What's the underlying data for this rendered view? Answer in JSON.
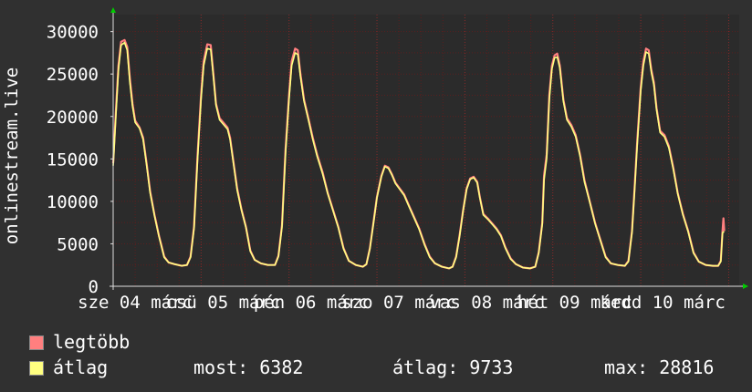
{
  "chart_data": {
    "type": "line",
    "ylabel": "onlinestream.live",
    "ylim": [
      0,
      32000
    ],
    "yticks": [
      0,
      5000,
      10000,
      15000,
      20000,
      25000,
      30000
    ],
    "xticks": [
      {
        "x": 0.25,
        "label": "sze 04 márc"
      },
      {
        "x": 1.25,
        "label": "csü 05 márc"
      },
      {
        "x": 2.25,
        "label": "pén 06 márc"
      },
      {
        "x": 3.25,
        "label": "szo 07 márc"
      },
      {
        "x": 4.25,
        "label": "vas 08 márc"
      },
      {
        "x": 5.25,
        "label": "hét 09 márc"
      },
      {
        "x": 6.25,
        "label": "kedd 10 márc"
      }
    ],
    "xlim": [
      0,
      7.12
    ],
    "grid": true,
    "colors": {
      "background": "#303030",
      "plot": "#2b2b2b",
      "grid": "#5a1f1f",
      "max_series": "#ff7f7f",
      "avg_series": "#ffff80",
      "axis": "#ffffff",
      "arrow": "#00cc00"
    },
    "series": [
      {
        "name": "legtöbb",
        "color": "#ff7f7f",
        "points": [
          [
            0.0,
            14500
          ],
          [
            0.03,
            20500
          ],
          [
            0.06,
            26000
          ],
          [
            0.09,
            28800
          ],
          [
            0.13,
            29000
          ],
          [
            0.16,
            28200
          ],
          [
            0.19,
            24500
          ],
          [
            0.22,
            21500
          ],
          [
            0.25,
            19500
          ],
          [
            0.3,
            18700
          ],
          [
            0.34,
            17500
          ],
          [
            0.38,
            14500
          ],
          [
            0.42,
            11200
          ],
          [
            0.47,
            8400
          ],
          [
            0.52,
            6000
          ],
          [
            0.58,
            3500
          ],
          [
            0.63,
            2800
          ],
          [
            0.7,
            2600
          ],
          [
            0.78,
            2400
          ],
          [
            0.84,
            2500
          ],
          [
            0.88,
            3500
          ],
          [
            0.92,
            7000
          ],
          [
            0.96,
            15500
          ],
          [
            1.0,
            22500
          ],
          [
            1.03,
            26500
          ],
          [
            1.07,
            28500
          ],
          [
            1.11,
            28400
          ],
          [
            1.14,
            25000
          ],
          [
            1.17,
            21500
          ],
          [
            1.21,
            19800
          ],
          [
            1.26,
            19200
          ],
          [
            1.3,
            18700
          ],
          [
            1.33,
            17500
          ],
          [
            1.37,
            14500
          ],
          [
            1.41,
            11500
          ],
          [
            1.46,
            9000
          ],
          [
            1.51,
            7000
          ],
          [
            1.56,
            4200
          ],
          [
            1.61,
            3100
          ],
          [
            1.68,
            2700
          ],
          [
            1.76,
            2500
          ],
          [
            1.84,
            2500
          ],
          [
            1.88,
            3600
          ],
          [
            1.92,
            7200
          ],
          [
            1.96,
            16000
          ],
          [
            2.0,
            22500
          ],
          [
            2.03,
            26500
          ],
          [
            2.07,
            28000
          ],
          [
            2.1,
            27800
          ],
          [
            2.13,
            25000
          ],
          [
            2.17,
            22000
          ],
          [
            2.22,
            19800
          ],
          [
            2.27,
            17500
          ],
          [
            2.32,
            15500
          ],
          [
            2.38,
            13500
          ],
          [
            2.44,
            11000
          ],
          [
            2.5,
            9000
          ],
          [
            2.56,
            7000
          ],
          [
            2.62,
            4500
          ],
          [
            2.68,
            3000
          ],
          [
            2.76,
            2500
          ],
          [
            2.84,
            2300
          ],
          [
            2.88,
            2600
          ],
          [
            2.92,
            4500
          ],
          [
            2.96,
            7500
          ],
          [
            3.0,
            10500
          ],
          [
            3.05,
            13000
          ],
          [
            3.09,
            14200
          ],
          [
            3.13,
            14000
          ],
          [
            3.17,
            13200
          ],
          [
            3.21,
            12200
          ],
          [
            3.26,
            11500
          ],
          [
            3.31,
            10800
          ],
          [
            3.36,
            9600
          ],
          [
            3.42,
            8200
          ],
          [
            3.48,
            6800
          ],
          [
            3.54,
            5000
          ],
          [
            3.6,
            3500
          ],
          [
            3.66,
            2700
          ],
          [
            3.74,
            2300
          ],
          [
            3.82,
            2100
          ],
          [
            3.86,
            2300
          ],
          [
            3.9,
            3500
          ],
          [
            3.94,
            6000
          ],
          [
            3.98,
            9000
          ],
          [
            4.02,
            11500
          ],
          [
            4.06,
            12700
          ],
          [
            4.1,
            12900
          ],
          [
            4.14,
            12300
          ],
          [
            4.17,
            10500
          ],
          [
            4.21,
            8500
          ],
          [
            4.26,
            8000
          ],
          [
            4.31,
            7400
          ],
          [
            4.36,
            6800
          ],
          [
            4.41,
            6000
          ],
          [
            4.46,
            4600
          ],
          [
            4.52,
            3300
          ],
          [
            4.58,
            2600
          ],
          [
            4.66,
            2200
          ],
          [
            4.74,
            2100
          ],
          [
            4.8,
            2300
          ],
          [
            4.84,
            4000
          ],
          [
            4.88,
            7500
          ],
          [
            4.9,
            13000
          ],
          [
            4.93,
            15500
          ],
          [
            4.96,
            22500
          ],
          [
            4.99,
            26000
          ],
          [
            5.02,
            27200
          ],
          [
            5.05,
            27400
          ],
          [
            5.08,
            26000
          ],
          [
            5.12,
            22000
          ],
          [
            5.16,
            19800
          ],
          [
            5.21,
            19000
          ],
          [
            5.26,
            17800
          ],
          [
            5.31,
            15500
          ],
          [
            5.36,
            12500
          ],
          [
            5.42,
            10000
          ],
          [
            5.48,
            7500
          ],
          [
            5.54,
            5500
          ],
          [
            5.6,
            3500
          ],
          [
            5.66,
            2700
          ],
          [
            5.74,
            2500
          ],
          [
            5.82,
            2400
          ],
          [
            5.86,
            3000
          ],
          [
            5.9,
            6500
          ],
          [
            5.93,
            11500
          ],
          [
            5.96,
            17000
          ],
          [
            6.0,
            23500
          ],
          [
            6.03,
            26500
          ],
          [
            6.06,
            28000
          ],
          [
            6.09,
            27800
          ],
          [
            6.12,
            25500
          ],
          [
            6.15,
            24000
          ],
          [
            6.18,
            21000
          ],
          [
            6.22,
            18300
          ],
          [
            6.27,
            17800
          ],
          [
            6.32,
            16500
          ],
          [
            6.37,
            14000
          ],
          [
            6.42,
            11000
          ],
          [
            6.48,
            8500
          ],
          [
            6.54,
            6500
          ],
          [
            6.6,
            4000
          ],
          [
            6.66,
            2900
          ],
          [
            6.74,
            2500
          ],
          [
            6.82,
            2400
          ],
          [
            6.88,
            2400
          ],
          [
            6.91,
            3000
          ],
          [
            6.93,
            6500
          ],
          [
            6.94,
            8000
          ],
          [
            6.95,
            6500
          ]
        ]
      },
      {
        "name": "átlag",
        "color": "#ffff80",
        "points": [
          [
            0.0,
            14200
          ],
          [
            0.03,
            20000
          ],
          [
            0.06,
            25500
          ],
          [
            0.09,
            28400
          ],
          [
            0.13,
            28700
          ],
          [
            0.16,
            27800
          ],
          [
            0.19,
            24000
          ],
          [
            0.22,
            21200
          ],
          [
            0.25,
            19300
          ],
          [
            0.3,
            18600
          ],
          [
            0.34,
            17300
          ],
          [
            0.38,
            14300
          ],
          [
            0.42,
            11000
          ],
          [
            0.47,
            8300
          ],
          [
            0.52,
            5900
          ],
          [
            0.58,
            3400
          ],
          [
            0.63,
            2800
          ],
          [
            0.7,
            2600
          ],
          [
            0.78,
            2400
          ],
          [
            0.84,
            2500
          ],
          [
            0.88,
            3400
          ],
          [
            0.92,
            6800
          ],
          [
            0.96,
            15000
          ],
          [
            1.0,
            22000
          ],
          [
            1.03,
            26000
          ],
          [
            1.07,
            28000
          ],
          [
            1.11,
            27900
          ],
          [
            1.14,
            24700
          ],
          [
            1.17,
            21300
          ],
          [
            1.21,
            19600
          ],
          [
            1.26,
            19000
          ],
          [
            1.3,
            18500
          ],
          [
            1.33,
            17300
          ],
          [
            1.37,
            14300
          ],
          [
            1.41,
            11300
          ],
          [
            1.46,
            8900
          ],
          [
            1.51,
            6900
          ],
          [
            1.56,
            4100
          ],
          [
            1.61,
            3100
          ],
          [
            1.68,
            2700
          ],
          [
            1.76,
            2500
          ],
          [
            1.84,
            2500
          ],
          [
            1.88,
            3500
          ],
          [
            1.92,
            7000
          ],
          [
            1.96,
            15500
          ],
          [
            2.0,
            22000
          ],
          [
            2.03,
            26000
          ],
          [
            2.07,
            27500
          ],
          [
            2.1,
            27300
          ],
          [
            2.13,
            24700
          ],
          [
            2.17,
            21800
          ],
          [
            2.22,
            19600
          ],
          [
            2.27,
            17300
          ],
          [
            2.32,
            15300
          ],
          [
            2.38,
            13300
          ],
          [
            2.44,
            10900
          ],
          [
            2.5,
            8900
          ],
          [
            2.56,
            6900
          ],
          [
            2.62,
            4400
          ],
          [
            2.68,
            3000
          ],
          [
            2.76,
            2500
          ],
          [
            2.84,
            2300
          ],
          [
            2.88,
            2600
          ],
          [
            2.92,
            4400
          ],
          [
            2.96,
            7400
          ],
          [
            3.0,
            10400
          ],
          [
            3.05,
            12900
          ],
          [
            3.09,
            14100
          ],
          [
            3.13,
            13900
          ],
          [
            3.17,
            13100
          ],
          [
            3.21,
            12100
          ],
          [
            3.26,
            11400
          ],
          [
            3.31,
            10700
          ],
          [
            3.36,
            9500
          ],
          [
            3.42,
            8100
          ],
          [
            3.48,
            6700
          ],
          [
            3.54,
            4900
          ],
          [
            3.6,
            3400
          ],
          [
            3.66,
            2700
          ],
          [
            3.74,
            2300
          ],
          [
            3.82,
            2100
          ],
          [
            3.86,
            2300
          ],
          [
            3.9,
            3400
          ],
          [
            3.94,
            5900
          ],
          [
            3.98,
            8900
          ],
          [
            4.02,
            11400
          ],
          [
            4.06,
            12600
          ],
          [
            4.1,
            12800
          ],
          [
            4.14,
            12200
          ],
          [
            4.17,
            10400
          ],
          [
            4.21,
            8400
          ],
          [
            4.26,
            7900
          ],
          [
            4.31,
            7300
          ],
          [
            4.36,
            6700
          ],
          [
            4.41,
            5900
          ],
          [
            4.46,
            4500
          ],
          [
            4.52,
            3200
          ],
          [
            4.58,
            2600
          ],
          [
            4.66,
            2200
          ],
          [
            4.74,
            2100
          ],
          [
            4.8,
            2300
          ],
          [
            4.84,
            3900
          ],
          [
            4.88,
            7300
          ],
          [
            4.9,
            12500
          ],
          [
            4.93,
            15000
          ],
          [
            4.96,
            22000
          ],
          [
            4.99,
            25600
          ],
          [
            5.02,
            26900
          ],
          [
            5.05,
            27000
          ],
          [
            5.08,
            25700
          ],
          [
            5.12,
            21800
          ],
          [
            5.16,
            19600
          ],
          [
            5.21,
            18800
          ],
          [
            5.26,
            17600
          ],
          [
            5.31,
            15300
          ],
          [
            5.36,
            12300
          ],
          [
            5.42,
            9900
          ],
          [
            5.48,
            7400
          ],
          [
            5.54,
            5400
          ],
          [
            5.6,
            3400
          ],
          [
            5.66,
            2700
          ],
          [
            5.74,
            2500
          ],
          [
            5.82,
            2400
          ],
          [
            5.86,
            2900
          ],
          [
            5.9,
            6300
          ],
          [
            5.93,
            11200
          ],
          [
            5.96,
            16600
          ],
          [
            6.0,
            23000
          ],
          [
            6.03,
            26000
          ],
          [
            6.06,
            27600
          ],
          [
            6.09,
            27400
          ],
          [
            6.12,
            25200
          ],
          [
            6.15,
            23700
          ],
          [
            6.18,
            20800
          ],
          [
            6.22,
            18100
          ],
          [
            6.27,
            17600
          ],
          [
            6.32,
            16300
          ],
          [
            6.37,
            13800
          ],
          [
            6.42,
            10900
          ],
          [
            6.48,
            8400
          ],
          [
            6.54,
            6400
          ],
          [
            6.6,
            3900
          ],
          [
            6.66,
            2900
          ],
          [
            6.74,
            2500
          ],
          [
            6.82,
            2400
          ],
          [
            6.88,
            2400
          ],
          [
            6.91,
            2900
          ],
          [
            6.93,
            6300
          ],
          [
            6.94,
            6400
          ],
          [
            6.95,
            6382
          ]
        ]
      }
    ]
  },
  "legend": {
    "items": [
      {
        "label": "legtöbb",
        "color": "#ff7f7f"
      },
      {
        "label": "átlag",
        "color": "#ffff80"
      }
    ],
    "stats": {
      "now_label": "most:",
      "now_value": "6382",
      "avg_label": "átlag:",
      "avg_value": "9733",
      "max_label": "max:",
      "max_value": "28816"
    }
  }
}
